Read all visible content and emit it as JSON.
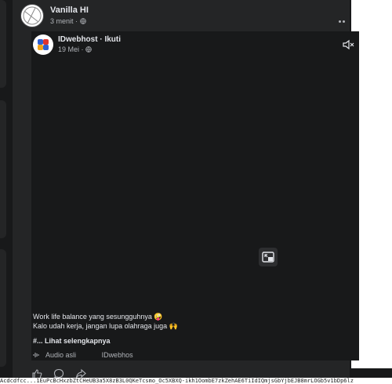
{
  "outer_post": {
    "author": "Vanilla HI",
    "time": "3 menit",
    "privacy_icon": "globe-icon",
    "more_icon": "more-horizontal-icon"
  },
  "shared_post": {
    "page_name": "IDwebhost",
    "separator": " · ",
    "follow_label": "Ikuti",
    "date": "19 Mei",
    "privacy_icon": "globe-icon",
    "mute_icon": "volume-muted-icon",
    "pip_icon": "picture-in-picture-icon"
  },
  "caption": {
    "line1": "Work life balance yang sesungguhnya 🤪",
    "line2": "Kalo udah kerja, jangan lupa olahraga juga 🙌",
    "hashtag": "#...",
    "see_more": "Lihat selengkapnya"
  },
  "audio": {
    "icon": "audio-wave-icon",
    "text": "Audio asli",
    "account": "IDwebhos"
  },
  "actions": {
    "like_icon": "like-icon",
    "comment_icon": "comment-icon",
    "share_icon": "share-icon"
  },
  "bottom_bar": {
    "url_text": "Acdcdfcc...1EuPcBcHxzbZtCHeUB3a5X8zB3L0QKeTcsmo_Oc5XBXQ-ikh1OombE7zkZehAE6TiIdIQmjsGbYjbEJB8mrLOGb5v1bDp6lz"
  },
  "colors": {
    "background": "#18191a",
    "card": "#242526",
    "text_primary": "#e4e6eb",
    "text_secondary": "#b0b3b8"
  }
}
